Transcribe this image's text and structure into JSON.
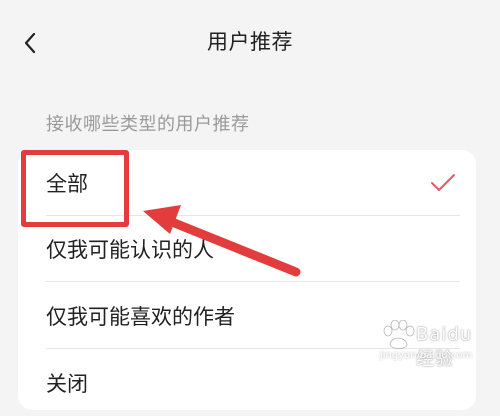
{
  "nav": {
    "title": "用户推荐"
  },
  "section_header": "接收哪些类型的用户推荐",
  "options": [
    {
      "label": "全部",
      "selected": true
    },
    {
      "label": "仅我可能认识的人",
      "selected": false
    },
    {
      "label": "仅我可能喜欢的作者",
      "selected": false
    },
    {
      "label": "关闭",
      "selected": false
    }
  ],
  "colors": {
    "accent_check": "#e15a6b",
    "annotation": "#e23c3c",
    "background": "#f4f4f4",
    "card": "#ffffff"
  },
  "watermark": {
    "name": "Baidu经验",
    "url": "jingyan.baidu.com"
  }
}
